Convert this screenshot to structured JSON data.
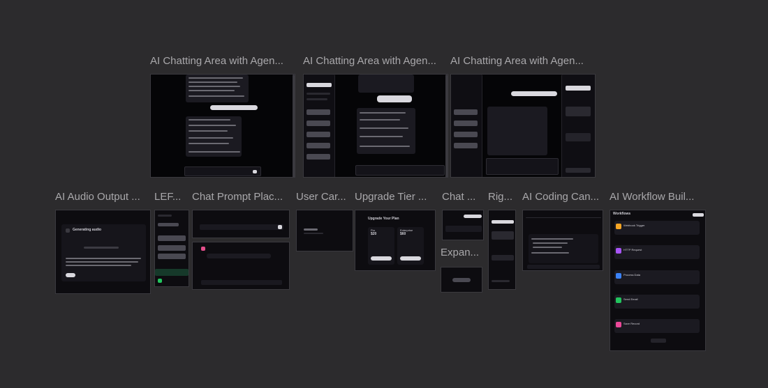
{
  "frames": [
    {
      "id": "agent-chat-1",
      "title": "AI Chatting Area with Agen..."
    },
    {
      "id": "agent-chat-2",
      "title": "AI Chatting Area with Agen..."
    },
    {
      "id": "agent-chat-3",
      "title": "AI Chatting Area with Agen..."
    },
    {
      "id": "audio-output",
      "title": "AI Audio Output ..."
    },
    {
      "id": "left-panel",
      "title": "LEF..."
    },
    {
      "id": "chat-prompt",
      "title": "Chat Prompt Plac..."
    },
    {
      "id": "user-card",
      "title": "User Car..."
    },
    {
      "id": "upgrade-tier",
      "title": "Upgrade Tier ..."
    },
    {
      "id": "chat-small",
      "title": "Chat ..."
    },
    {
      "id": "expand",
      "title": "Expan..."
    },
    {
      "id": "right-panel",
      "title": "Rig..."
    },
    {
      "id": "coding-canvas",
      "title": "AI Coding Can..."
    },
    {
      "id": "workflow-builder",
      "title": "AI Workflow Buil..."
    }
  ],
  "previews": {
    "upgrade": {
      "heading": "Upgrade Your Plan",
      "plan_pro": "Pro",
      "price_pro": "$20",
      "plan_ent": "Enterprise",
      "price_ent": "$60",
      "cta_pro": "Upgrade to Pro",
      "cta_ent": "Upgrade to Enterprise"
    },
    "workflow": {
      "title": "Workflows",
      "nodes": [
        {
          "label": "Webhook Trigger",
          "color": "#f5a524"
        },
        {
          "label": "HTTP Request",
          "color": "#a855f7"
        },
        {
          "label": "Process Data",
          "color": "#3b82f6"
        },
        {
          "label": "Send Email",
          "color": "#22c55e"
        },
        {
          "label": "Save Record",
          "color": "#ec4899"
        }
      ]
    },
    "audio": {
      "title": "Generating audio"
    }
  }
}
